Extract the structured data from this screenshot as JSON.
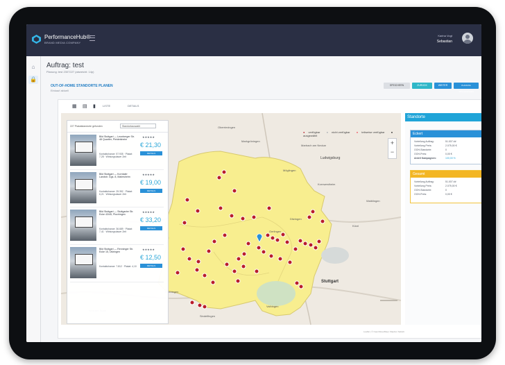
{
  "app": {
    "brand": "PerformanceHub®",
    "brand_sub": "BRAND MEDIA COMPANY",
    "user_label": "Karina Vogt",
    "user_name": "Sebastian"
  },
  "page": {
    "title": "Auftrag: test",
    "subtitle": "Planung: test 2307227 (abweicht: 14p)"
  },
  "section": {
    "title": "OUT-OF-HOME STANDORTE PLANEN",
    "subtitle": "Einkauf aktuell"
  },
  "buttons": {
    "speichern": "SPEICHERN",
    "zurueck": "ZURÜCK",
    "weiter": "WEITER",
    "abschliessen": "PLANUNG ABSCHLIESSEN"
  },
  "toolbar": {
    "list_label": "LISTE",
    "detail_label": "DETAILS"
  },
  "listing": {
    "count": "227 Plakatstandorte gefunden",
    "sort": "Standortauswahl"
  },
  "cards": [
    {
      "name": "Bild Stuttgart — Leonberger Str. 48 Quartier, Pleidelsheim",
      "stars": "★★★★★",
      "price": "€ 21,30",
      "meta": "Kontaktchance: 57.935 · Plakat: 7,28 · Wirkungsdauer Zeit",
      "btn": "DETAILS"
    },
    {
      "name": "Bild Stuttgart — Korntaler Landstr. Ggs. 8, Malmsheim",
      "stars": "★★★★★",
      "price": "€ 19,00",
      "meta": "Kontaktchance: 25.352 · Plakat: 6,21 · Wirkungsdauer Zeit",
      "btn": "DETAILS"
    },
    {
      "name": "Bild Stuttgart — Stuttgarter Str. Ecke 43/45, Plochingen",
      "stars": "★★★★★",
      "price": "€ 33,20",
      "meta": "Kontaktchance: 36.689 · Plakat: 7,41 · Wirkungsdauer Zeit",
      "btn": "DETAILS"
    },
    {
      "name": "Bild Stuttgart — Renninger Str. Ecke 15, Ditzingen",
      "stars": "★★★★★",
      "price": "€ 12,50",
      "meta": "Kontaktchance: 7.812 · Plakat: 4,10",
      "btn": "DETAILS"
    }
  ],
  "legend": [
    {
      "label": "verfügbar",
      "color": "#b91d2a"
    },
    {
      "label": "nicht verfügbar",
      "color": "#a9adb3"
    },
    {
      "label": "teilweise verfügbar",
      "color": "#ef4b59"
    },
    {
      "label": "ausgewählt",
      "color": "#1e1e1e"
    }
  ],
  "map_labels": {
    "oberriexingen": "Oberriexingen",
    "marbach": "Marbach am Neckar",
    "ludwigsburg": "Ludwigsburg",
    "kornwestheim": "Kornwestheim",
    "stuttgart": "Stuttgart",
    "weil": "Weil der Stadt",
    "waiblingen": "Waiblingen",
    "gerlingen": "Gerlingen",
    "renningen": "Renningen",
    "ditzingen": "Ditzingen",
    "sindelfingen": "Sindelfingen",
    "markgroeningen": "Markgröningen",
    "moeglingen": "Möglingen",
    "vaihingen": "Vaihingen",
    "kuerzl": "Kürzl"
  },
  "right_panel": {
    "title": "Standorte",
    "box1_title": "Eckert",
    "box1_rows": [
      [
        "Vorteilung Auftrag:",
        "51.007 ##"
      ],
      [
        "Vorteilung Preis:",
        "2.075,00 €"
      ],
      [
        "OOH-Standorte:",
        "0"
      ],
      [
        "OOH-Preis:",
        "0,00 €"
      ],
      [
        "Anteil Kampagnen:",
        "100,00 %"
      ]
    ],
    "box2_title": "Gesamt",
    "box2_rows": [
      [
        "Vorteilung Auftrag:",
        "51.007 ##"
      ],
      [
        "Vorteilung Preis:",
        "2.075,00 €"
      ],
      [
        "OOH-Standorte:",
        "0"
      ],
      [
        "OOH-Preis:",
        "0,00 €"
      ]
    ]
  },
  "footer": "Leaflet | © OpenStreetMap | Mapbox Sattelit",
  "colors": {
    "header": "#2a2f44",
    "accent": "#20a4d8",
    "region": "#f8ee8f",
    "marker_red": "#b91d2a",
    "marker_white": "#ffffff"
  },
  "icons": [
    "home-icon",
    "lock-icon",
    "gear-icon",
    "map-icon",
    "list-icon",
    "chevron-icon"
  ]
}
